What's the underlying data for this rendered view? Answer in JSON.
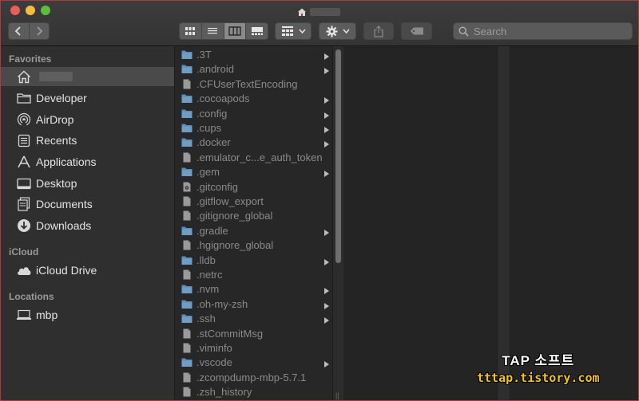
{
  "window": {
    "title_icon": "home-icon"
  },
  "toolbar": {
    "nav": [
      "chevron-left-icon",
      "chevron-right-icon"
    ],
    "views": [
      "icon-view",
      "list-view",
      "column-view",
      "gallery-view"
    ],
    "active_view": "column-view",
    "search_placeholder": "Search"
  },
  "sidebar": {
    "favorites_title": "Favorites",
    "icloud_title": "iCloud",
    "locations_title": "Locations",
    "favorites": [
      {
        "label": "",
        "icon": "home-icon"
      },
      {
        "label": "Developer",
        "icon": "folder-icon"
      },
      {
        "label": "AirDrop",
        "icon": "airdrop-icon"
      },
      {
        "label": "Recents",
        "icon": "recents-icon"
      },
      {
        "label": "Applications",
        "icon": "applications-icon"
      },
      {
        "label": "Desktop",
        "icon": "desktop-icon"
      },
      {
        "label": "Documents",
        "icon": "documents-icon"
      },
      {
        "label": "Downloads",
        "icon": "downloads-icon"
      }
    ],
    "icloud": [
      {
        "label": "iCloud Drive",
        "icon": "cloud-icon"
      }
    ],
    "locations": [
      {
        "label": "mbp",
        "icon": "laptop-icon"
      }
    ]
  },
  "files": [
    {
      "name": ".3T",
      "kind": "folder"
    },
    {
      "name": ".android",
      "kind": "folder"
    },
    {
      "name": ".CFUserTextEncoding",
      "kind": "file"
    },
    {
      "name": ".cocoapods",
      "kind": "folder"
    },
    {
      "name": ".config",
      "kind": "folder"
    },
    {
      "name": ".cups",
      "kind": "folder"
    },
    {
      "name": ".docker",
      "kind": "folder"
    },
    {
      "name": ".emulator_c...e_auth_token",
      "kind": "file"
    },
    {
      "name": ".gem",
      "kind": "folder"
    },
    {
      "name": ".gitconfig",
      "kind": "config"
    },
    {
      "name": ".gitflow_export",
      "kind": "file"
    },
    {
      "name": ".gitignore_global",
      "kind": "file"
    },
    {
      "name": ".gradle",
      "kind": "folder"
    },
    {
      "name": ".hgignore_global",
      "kind": "file"
    },
    {
      "name": ".lldb",
      "kind": "folder"
    },
    {
      "name": ".netrc",
      "kind": "file"
    },
    {
      "name": ".nvm",
      "kind": "folder"
    },
    {
      "name": ".oh-my-zsh",
      "kind": "folder"
    },
    {
      "name": ".ssh",
      "kind": "folder"
    },
    {
      "name": ".stCommitMsg",
      "kind": "file"
    },
    {
      "name": ".viminfo",
      "kind": "file"
    },
    {
      "name": ".vscode",
      "kind": "folder"
    },
    {
      "name": ".zcompdump-mbp-5.7.1",
      "kind": "file"
    },
    {
      "name": ".zsh_history",
      "kind": "file"
    }
  ],
  "column_resize_glyph": "||",
  "watermark": {
    "title": "TAP 소프트",
    "url": "tttap.tistory.com"
  },
  "colors": {
    "folder": "#5b8fb9",
    "file": "#9a9a9a",
    "accent_close": "#ee5e56"
  }
}
